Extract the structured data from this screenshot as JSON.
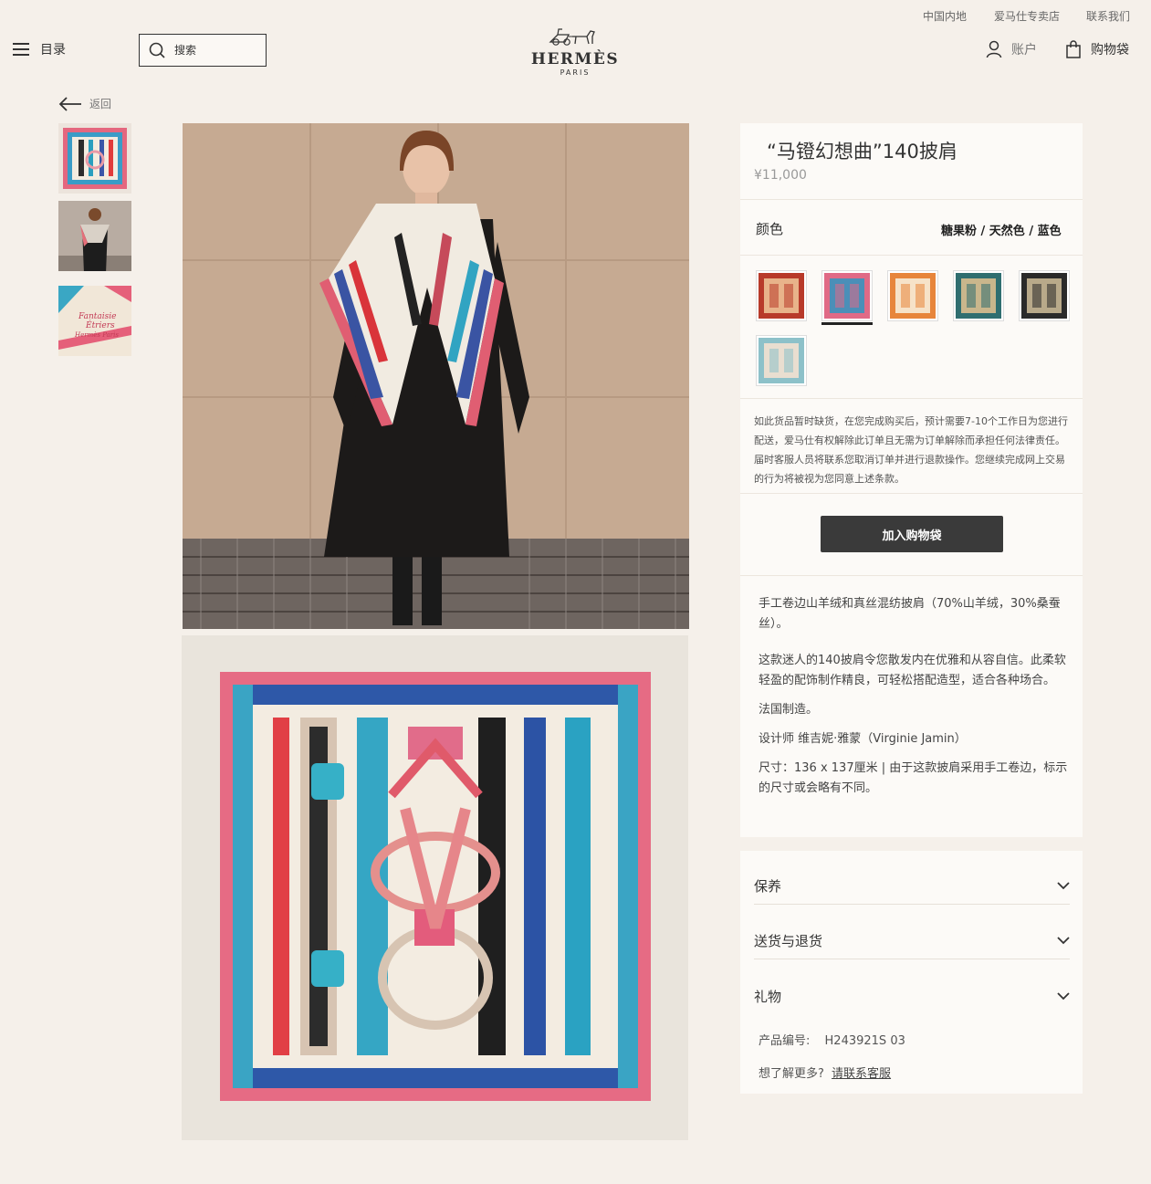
{
  "utility": {
    "region": "中国内地",
    "stores": "爱马仕专卖店",
    "contact": "联系我们"
  },
  "header": {
    "menu_label": "目录",
    "search_placeholder": "搜索",
    "logo_brand": "HERMÈS",
    "logo_sub": "PARIS",
    "account_label": "账户",
    "bag_label": "购物袋"
  },
  "back_label": "返回",
  "thumb_text": {
    "line1": "Fantaisie",
    "line2": "Étriers",
    "line3": "Hermès Paris"
  },
  "product": {
    "title": "“马镫幻想曲”140披肩",
    "price": "¥11,000",
    "color_label": "颜色",
    "color_value": "糖果粉 / 天然色 / 蓝色",
    "notice": "如此货品暂时缺货，在您完成购买后，预计需要7-10个工作日为您进行配送，爱马仕有权解除此订单且无需为订单解除而承担任何法律责任。届时客服人员将联系您取消订单并进行退款操作。您继续完成网上交易的行为将被视为您同意上述条款。",
    "add_to_bag": "加入购物袋",
    "desc1": "手工卷边山羊绒和真丝混纺披肩（70%山羊绒，30%桑蚕丝）。",
    "desc2": "这款迷人的140披肩令您散发内在优雅和从容自信。此柔软轻盈的配饰制作精良，可轻松搭配造型，适合各种场合。",
    "desc3": "法国制造。",
    "desc4": "设计师 维吉妮·雅蒙（Virginie Jamin）",
    "desc5": "尺寸：136 x 137厘米 | 由于这款披肩采用手工卷边，标示的尺寸或会略有不同。",
    "sku_label": "产品编号:",
    "sku_value": "H243921S 03",
    "more_label": "想了解更多?",
    "more_link": "请联系客服"
  },
  "accordion": [
    "保养",
    "送货与退货",
    "礼物"
  ],
  "swatch_colors": [
    {
      "name": "red",
      "main": "#b83a2a",
      "accent": "#e8b38a"
    },
    {
      "name": "candy-pink",
      "main": "#e06a86",
      "accent": "#4b8fb8",
      "selected": true
    },
    {
      "name": "orange",
      "main": "#e7853b",
      "accent": "#f6e2c8"
    },
    {
      "name": "teal",
      "main": "#2f6e70",
      "accent": "#c9b68c"
    },
    {
      "name": "black",
      "main": "#2a2a2a",
      "accent": "#b8a98a"
    },
    {
      "name": "sky",
      "main": "#8dc1c9",
      "accent": "#e9ded0"
    }
  ]
}
